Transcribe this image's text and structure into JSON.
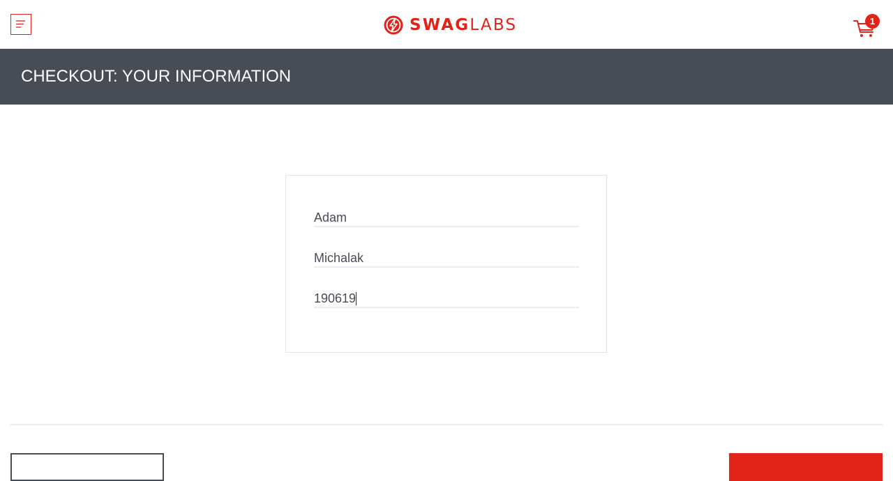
{
  "app": {
    "brand_strong": "SWAG",
    "brand_light": "LABS",
    "brand_color": "#e2231a"
  },
  "header": {
    "menu_icon": "menu-icon",
    "cart_icon": "shopping-cart-icon",
    "cart_count": "1"
  },
  "subheader": {
    "title": "CHECKOUT: YOUR INFORMATION",
    "background": "#474c55"
  },
  "form": {
    "first_name": "Adam",
    "last_name": "Michalak",
    "postal_code": "190619"
  }
}
